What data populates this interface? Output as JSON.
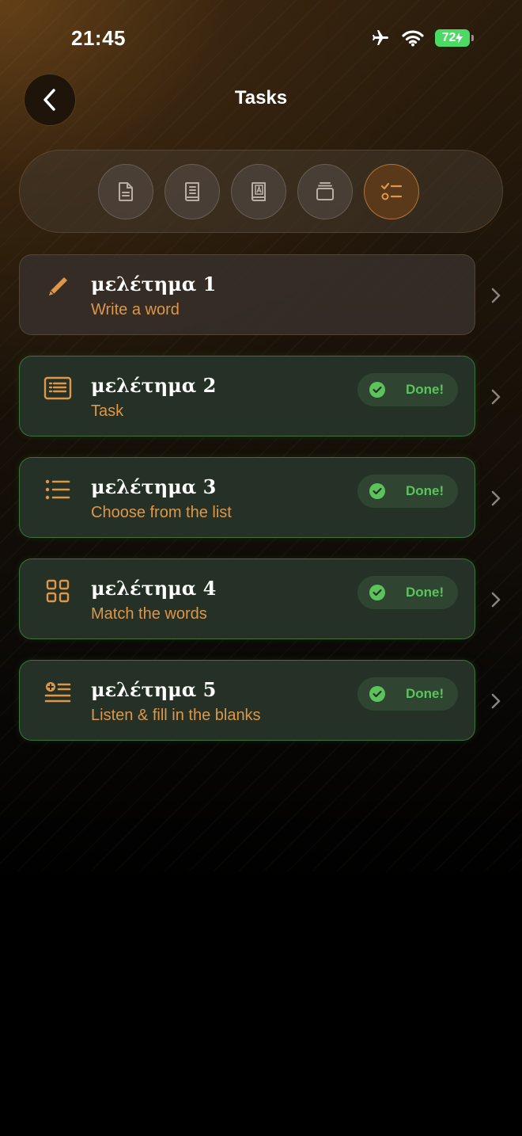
{
  "status_bar": {
    "time": "21:45",
    "battery": "72"
  },
  "header": {
    "title": "Tasks"
  },
  "tabs": [
    {
      "icon": "document-icon",
      "active": false
    },
    {
      "icon": "book-icon",
      "active": false
    },
    {
      "icon": "dictionary-icon",
      "active": false
    },
    {
      "icon": "stack-icon",
      "active": false
    },
    {
      "icon": "checklist-icon",
      "active": true
    }
  ],
  "tasks": [
    {
      "title": "μελέτημα 1",
      "subtitle": "Write a word",
      "status": "",
      "done": false,
      "icon": "pencil-icon"
    },
    {
      "title": "μελέτημα 2",
      "subtitle": "Task",
      "status": "Done!",
      "done": true,
      "icon": "task-card-icon"
    },
    {
      "title": "μελέτημα 3",
      "subtitle": "Choose from the list",
      "status": "Done!",
      "done": true,
      "icon": "list-icon"
    },
    {
      "title": "μελέτημα 4",
      "subtitle": "Match the words",
      "status": "Done!",
      "done": true,
      "icon": "grid-icon"
    },
    {
      "title": "μελέτημα 5",
      "subtitle": "Listen & fill in the blanks",
      "status": "Done!",
      "done": true,
      "icon": "fill-blanks-icon"
    }
  ],
  "colors": {
    "accent": "#de9648",
    "done_green": "#5cc35c",
    "done_card": "#253126"
  }
}
